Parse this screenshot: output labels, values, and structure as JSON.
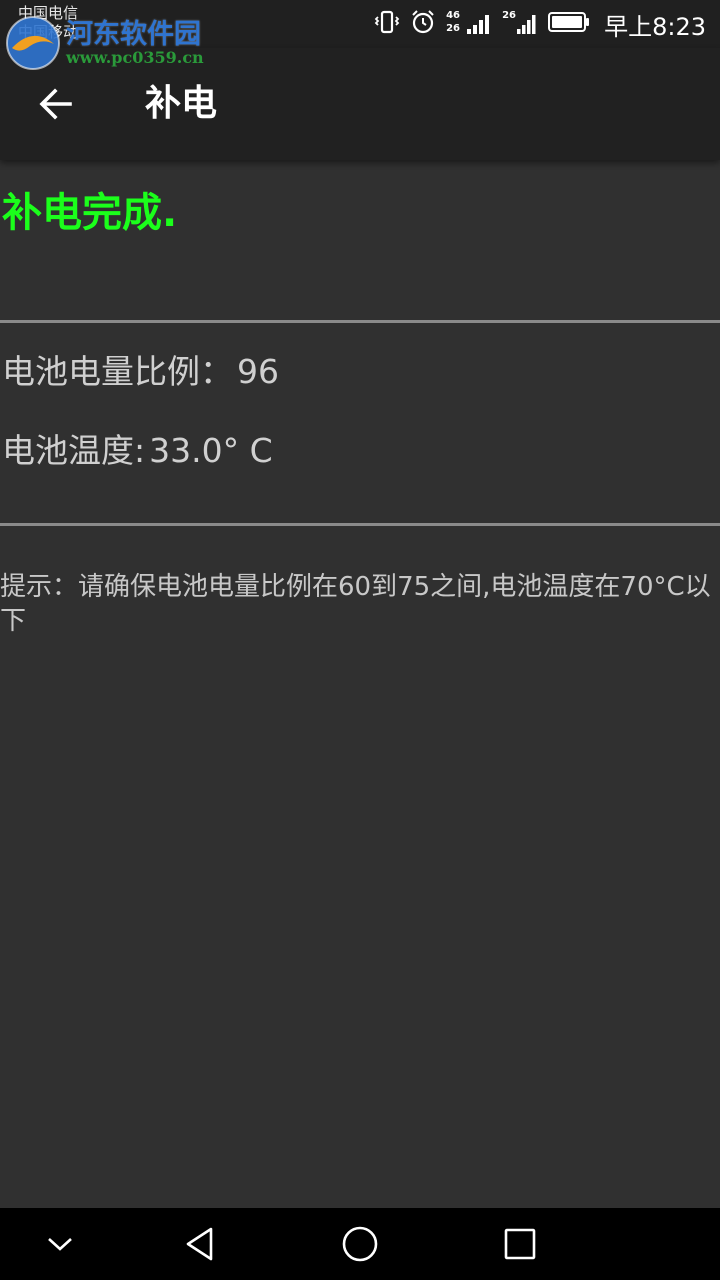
{
  "status_bar": {
    "carrier_1": "中国电信",
    "carrier_2": "中国移动",
    "watermark_title": "河东软件园",
    "watermark_url": "www.pc0359.cn",
    "network_1": "46",
    "network_2": "26",
    "network_3": "26",
    "time": "早上8:23",
    "icons": [
      "vibrate-icon",
      "alarm-icon",
      "signal-icon",
      "signal-icon",
      "battery-icon"
    ]
  },
  "app_bar": {
    "title": "补电",
    "back_icon": "arrow-left-icon"
  },
  "content": {
    "status_message": "补电完成.",
    "battery_level_label": "电池电量比例：",
    "battery_level_value": "96",
    "battery_temp_label": "电池温度:",
    "battery_temp_value": "33.0° C",
    "hint": "提示：请确保电池电量比例在60到75之间,电池温度在70°C以下"
  },
  "nav_bar": {
    "icons": [
      "chevron-down-icon",
      "triangle-back-icon",
      "circle-home-icon",
      "square-recent-icon"
    ]
  },
  "colors": {
    "background": "#303030",
    "app_bar": "#212121",
    "status_bar": "#202020",
    "success_green": "#1bff1b",
    "text_gray": "#d0d0d0",
    "divider": "#8a8a8a"
  }
}
